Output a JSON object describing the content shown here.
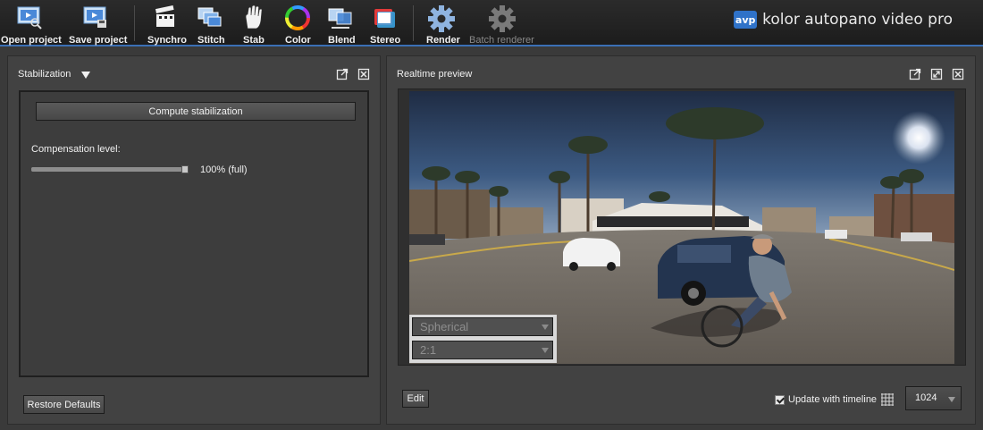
{
  "toolbar": {
    "buttons": [
      {
        "label": "Open project",
        "icon": "open-project-icon"
      },
      {
        "label": "Save project",
        "icon": "save-project-icon"
      },
      {
        "label": "Synchro",
        "icon": "clapperboard-icon"
      },
      {
        "label": "Stitch",
        "icon": "stitch-icon"
      },
      {
        "label": "Stab",
        "icon": "hand-icon"
      },
      {
        "label": "Color",
        "icon": "color-wheel-icon"
      },
      {
        "label": "Blend",
        "icon": "blend-icon"
      },
      {
        "label": "Stereo",
        "icon": "stereo-icon"
      },
      {
        "label": "Render",
        "icon": "gear-icon"
      },
      {
        "label": "Batch renderer",
        "icon": "gear-icon",
        "disabled": true
      }
    ],
    "brand_logo": "avp",
    "brand_name": "kolor autopano video pro",
    "accent_color": "#3b6fb5"
  },
  "stabilization": {
    "title": "Stabilization",
    "compute_label": "Compute stabilization",
    "compensation_label": "Compensation level:",
    "compensation_value": 1.0,
    "compensation_text": "100% (full)",
    "restore_label": "Restore Defaults"
  },
  "preview": {
    "title": "Realtime preview",
    "projection": "Spherical",
    "ratio": "2:1",
    "edit_label": "Edit",
    "update_label": "Update with timeline",
    "update_checked": true,
    "resolution": "1024"
  }
}
